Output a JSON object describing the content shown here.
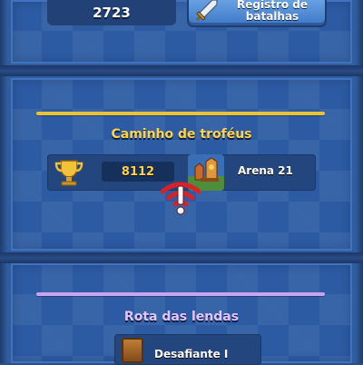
{
  "top": {
    "trophies": "2723",
    "battle_log_label_line1": "Registro de",
    "battle_log_label_line2": "batalhas"
  },
  "trophy_road": {
    "title": "Caminho de troféus",
    "trophies": "8112",
    "arena": "Arena 21",
    "accent_color": "#e9c23a"
  },
  "path_of_legends": {
    "title": "Rota das lendas",
    "rank": "Desafiante I",
    "accent_color": "#c8a4f2"
  },
  "icons": [
    "sword-icon",
    "trophy-cup-icon",
    "arena-icon",
    "wifi-warning-icon",
    "legend-rank-icon"
  ]
}
